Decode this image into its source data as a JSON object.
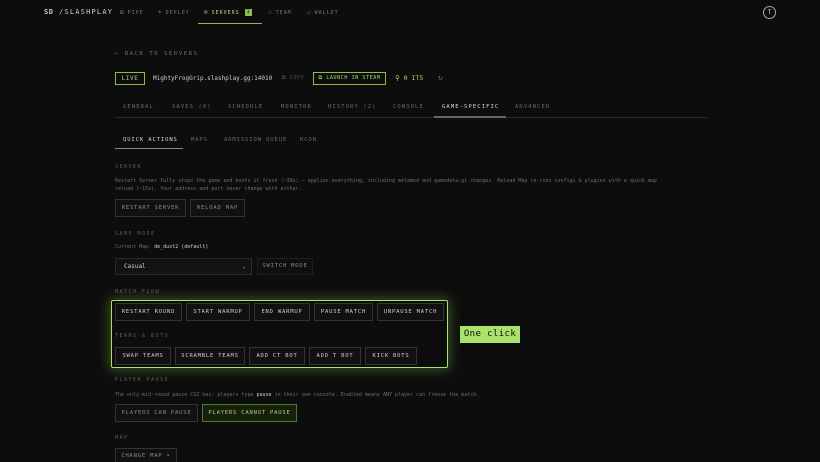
{
  "brand": {
    "mark": "SD",
    "name": "/SLASHPLAY"
  },
  "nav": {
    "items": [
      {
        "label": "PIPE",
        "icon": "pipe-icon",
        "glyph": "⊞"
      },
      {
        "label": "DEPLOY",
        "icon": "plus-icon",
        "glyph": "+"
      },
      {
        "label": "SERVERS",
        "icon": "servers-icon",
        "glyph": "⊘",
        "active": true,
        "badge": "1"
      },
      {
        "label": "TEAM",
        "icon": "team-icon",
        "glyph": "⚇"
      },
      {
        "label": "WALLET",
        "icon": "wallet-icon",
        "glyph": "▭"
      }
    ],
    "user_initial": "T"
  },
  "back_link": "← BACK TO SERVERS",
  "server": {
    "status": "LIVE",
    "address": "MightyFrogGrip.slashplay.gg:14010",
    "copy_label": "COPY",
    "steam_label": "LAUNCH IN STEAM",
    "players": "0 IT5"
  },
  "tabs": [
    "GENERAL",
    "SAVES (0)",
    "SCHEDULE",
    "MONITOR",
    "HISTORY (2)",
    "CONSOLE",
    "GAME-SPECIFIC",
    "ADVANCED"
  ],
  "subtabs": [
    "QUICK ACTIONS",
    "MAPS",
    "ADMISSION QUEUE",
    "RCON"
  ],
  "sections": {
    "server": {
      "label": "SERVER",
      "description_line1": "Restart Server fully stops the game and boots it fresh (~30s) — applies everything, including metamod and gamedata.gi changes. Reload Map re-runs configs & plugins with a quick map",
      "description_line2": "reload (~15s). Your address and port never change with either.",
      "buttons": [
        "RESTART SERVER",
        "RELOAD MAP"
      ]
    },
    "game_mode": {
      "label": "GAME MODE",
      "current_prefix": "Current Map:",
      "current_value": "de_dust2 (default)",
      "select_value": "Casual",
      "switch_button": "SWITCH MODE"
    },
    "match_flow": {
      "label": "MATCH FLOW",
      "buttons": [
        "RESTART ROUND",
        "START WARMUP",
        "END WARMUP",
        "PAUSE MATCH",
        "UNPAUSE MATCH"
      ]
    },
    "teams_bots": {
      "label": "TEAMS & BOTS",
      "buttons": [
        "SWAP TEAMS",
        "SCRAMBLE TEAMS",
        "ADD CT BOT",
        "ADD T BOT",
        "KICK BOTS"
      ]
    },
    "player_pause": {
      "label": "PLAYER PAUSE",
      "desc_before": "The only-mid-round pause CS2 has: players type",
      "desc_keyword": "pause",
      "desc_after": "in their own console. Enabled means ANY player can freeze the match.",
      "buttons": [
        "PLAYERS CAN PAUSE",
        "PLAYERS CANNOT PAUSE"
      ]
    },
    "map": {
      "label": "MAP",
      "button": "CHANGE MAP ▾"
    }
  },
  "callout": "One click",
  "colors": {
    "accent": "#a9e36a",
    "accent_dark": "#86c04a",
    "background": "#0d0d0d"
  }
}
